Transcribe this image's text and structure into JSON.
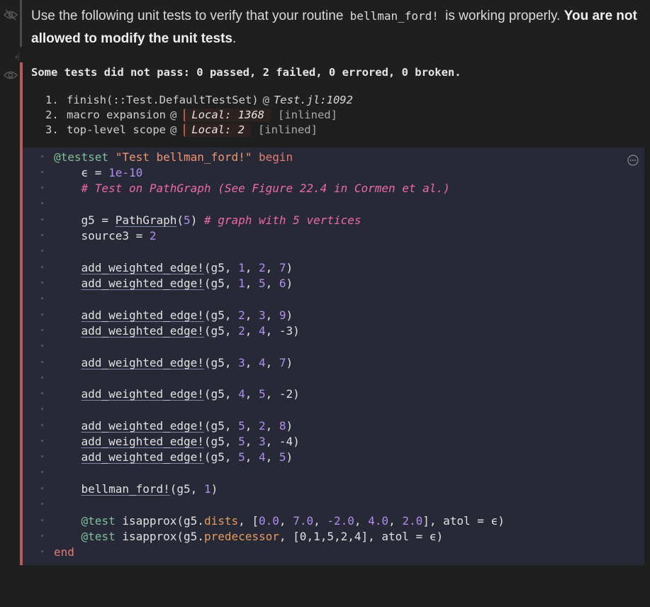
{
  "markdown_cell": {
    "text_before": "Use the following unit tests to verify that your routine ",
    "code": "bellman_ford!",
    "text_middle": " is working properly. ",
    "bold_text": "You are not allowed to modify the unit tests",
    "text_after": "."
  },
  "output": {
    "summary": "Some tests did not pass: 0 passed, 2 failed, 0 errored, 0 broken.",
    "stack": [
      {
        "num": "1.",
        "frame": "finish(::Test.DefaultTestSet)",
        "at": "@",
        "file": "Test.jl:1092",
        "local": "",
        "inlined": ""
      },
      {
        "num": "2.",
        "frame": "macro expansion",
        "at": "@",
        "file": "",
        "local": "Local: 1368",
        "inlined": "[inlined]"
      },
      {
        "num": "3.",
        "frame": "top-level scope",
        "at": "@",
        "file": "",
        "local": "Local: 2",
        "inlined": "[inlined]"
      }
    ]
  },
  "code": {
    "testset_macro": "@testset",
    "testset_name": "\"Test bellman_ford!\"",
    "begin_kw": "begin",
    "end_kw": "end",
    "eps_var": "ϵ",
    "eps_val": "1e-10",
    "comment1": "# Test on PathGraph (See Figure 22.4 in Cormen et al.)",
    "comment2": "# graph with 5 vertices",
    "graph_var": "g5",
    "graph_fn": "PathGraph",
    "graph_arg": "5",
    "source_var": "source3",
    "source_val": "2",
    "edge_fn": "add_weighted_edge!",
    "edges": [
      [
        "1",
        "2",
        "7"
      ],
      [
        "1",
        "5",
        "6"
      ],
      [
        "2",
        "3",
        "9"
      ],
      [
        "2",
        "4",
        "-3"
      ],
      [
        "3",
        "4",
        "7"
      ],
      [
        "4",
        "5",
        "-2"
      ],
      [
        "5",
        "2",
        "8"
      ],
      [
        "5",
        "3",
        "-4"
      ],
      [
        "5",
        "4",
        "5"
      ]
    ],
    "bf_fn": "bellman_ford!",
    "bf_args": "(g5, 1)",
    "test_macro": "@test",
    "test_fn": "isapprox",
    "dists_field": "dists",
    "dists_vals": [
      "0.0",
      "7.0",
      "-2.0",
      "4.0",
      "2.0"
    ],
    "pred_field": "predecessor",
    "pred_vals": "[0,1,5,2,4]",
    "atol_kw": "atol"
  },
  "icons": {
    "hidden_code": "eye-slash-icon",
    "visible_output": "eye-icon",
    "cell_menu": "ellipsis-circle-icon"
  },
  "colors": {
    "error_bar": "#b85a5a",
    "keyword": "#e37c74",
    "macro": "#7fbf9a",
    "string": "#f09572",
    "comment": "#ec6aa8",
    "number": "#b18ef0"
  }
}
